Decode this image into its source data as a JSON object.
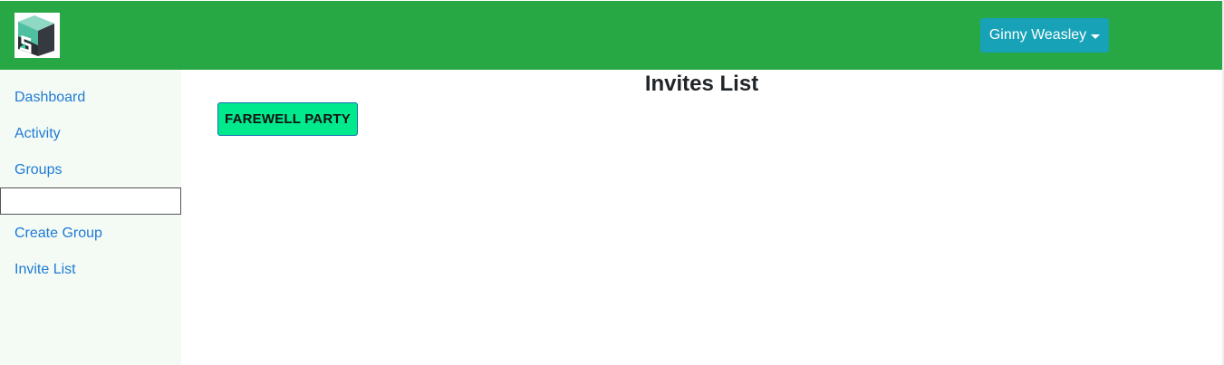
{
  "header": {
    "logo_icon": "app-logo-icon",
    "user_menu_label": "Ginny Weasley",
    "brand_color": "#28a745",
    "user_button_color": "#17a2b8"
  },
  "sidebar": {
    "items": [
      {
        "label": "Dashboard"
      },
      {
        "label": "Activity"
      },
      {
        "label": "Groups"
      },
      {
        "label": "Create Group"
      },
      {
        "label": "Invite List"
      }
    ],
    "search_value": "",
    "search_placeholder": ""
  },
  "main": {
    "title": "Invites List",
    "invites": [
      {
        "label": "FAREWELL PARTY",
        "color": "#00e98c"
      }
    ]
  }
}
